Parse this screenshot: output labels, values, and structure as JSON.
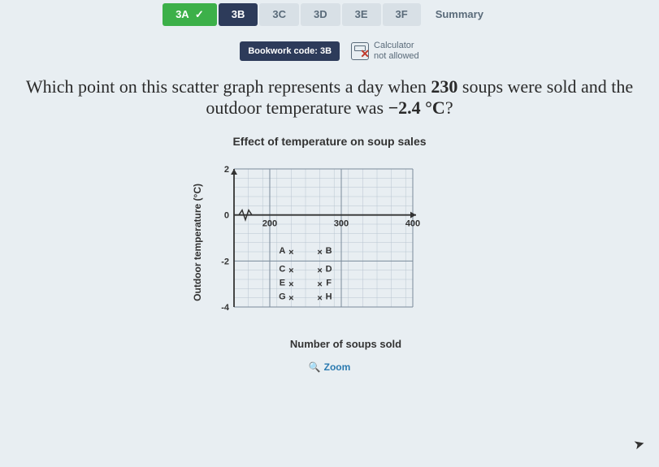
{
  "tabs": {
    "t3a": "3A",
    "t3b": "3B",
    "t3c": "3C",
    "t3d": "3D",
    "t3e": "3E",
    "t3f": "3F",
    "summary": "Summary"
  },
  "bookwork": "Bookwork code: 3B",
  "calculator": {
    "line1": "Calculator",
    "line2": "not allowed"
  },
  "question": {
    "part1": "Which point on this scatter graph represents a day when ",
    "num1": "230",
    "part2": " soups were sold and the outdoor temperature was ",
    "num2": "−2.4 °C",
    "part3": "?"
  },
  "chart_data": {
    "type": "scatter",
    "title": "Effect of temperature on soup sales",
    "xlabel": "Number of soups sold",
    "ylabel": "Outdoor temperature (°C)",
    "xlim": [
      150,
      400
    ],
    "ylim": [
      -4,
      2
    ],
    "xticks": [
      200,
      300,
      400
    ],
    "yticks": [
      -4,
      -2,
      0,
      2
    ],
    "series": [
      {
        "name": "A",
        "x": 230,
        "y": -1.6
      },
      {
        "name": "B",
        "x": 270,
        "y": -1.6
      },
      {
        "name": "C",
        "x": 230,
        "y": -2.4
      },
      {
        "name": "D",
        "x": 270,
        "y": -2.4
      },
      {
        "name": "E",
        "x": 230,
        "y": -3.0
      },
      {
        "name": "F",
        "x": 270,
        "y": -3.0
      },
      {
        "name": "G",
        "x": 230,
        "y": -3.6
      },
      {
        "name": "H",
        "x": 270,
        "y": -3.6
      }
    ]
  },
  "zoom": "Zoom"
}
